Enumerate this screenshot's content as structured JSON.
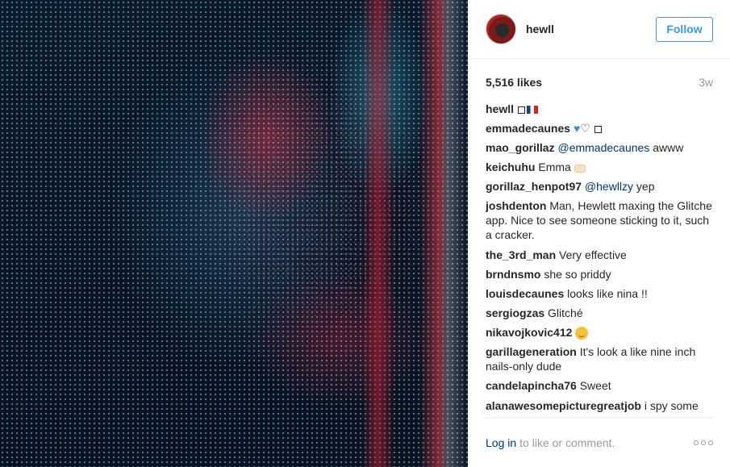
{
  "post": {
    "username": "hewll",
    "follow_label": "Follow",
    "likes": "5,516 likes",
    "time_ago": "3w"
  },
  "comments": [
    {
      "user": "hewll",
      "text": "",
      "emoji": "box-flag"
    },
    {
      "user": "emmadecaunes",
      "text": "",
      "emoji": "hearts-box"
    },
    {
      "user": "mao_gorillaz",
      "mention": "@emmadecaunes",
      "text": " awww"
    },
    {
      "user": "keichuhu",
      "text": " Emma ",
      "emoji": "hand"
    },
    {
      "user": "gorillaz_henpot97",
      "mention": "@hewllzy",
      "text": " yep"
    },
    {
      "user": "joshdenton",
      "text": " Man, Hewlett maxing the Glitche app. Nice to see someone sticking to it, such a cracker."
    },
    {
      "user": "the_3rd_man",
      "text": " Very effective"
    },
    {
      "user": "brndnsmo",
      "text": " she so priddy"
    },
    {
      "user": "louisdecaunes",
      "text": " looks like nina !!"
    },
    {
      "user": "sergiogzas",
      "text": " Glitché"
    },
    {
      "user": "nikavojkovic412",
      "text": " ",
      "emoji": "smile"
    },
    {
      "user": "garillageneration",
      "text": " It's look a like nine inch nails-only dude"
    },
    {
      "user": "candelapincha76",
      "text": " Sweet"
    },
    {
      "user": "alanawesomepicturegreatjob",
      "text": " i spy some"
    }
  ],
  "footer": {
    "login_label": "Log in",
    "login_rest": "to like or comment."
  },
  "icons": [
    "avatar",
    "more-options-icon"
  ]
}
